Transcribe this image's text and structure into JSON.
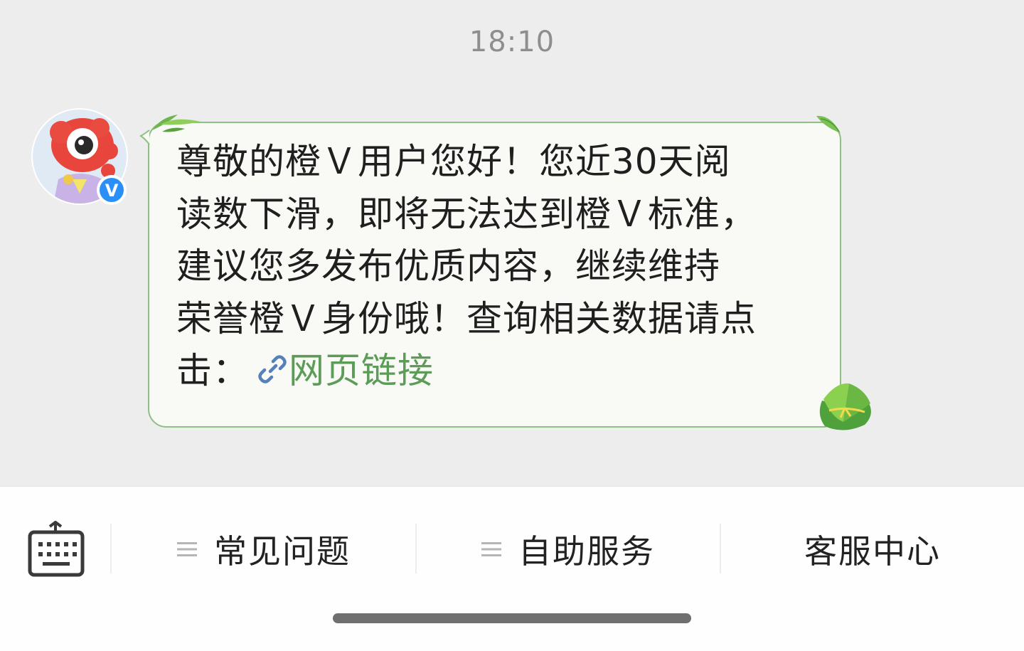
{
  "chat": {
    "timestamp": "18:10",
    "message": {
      "lines": [
        "尊敬的橙Ｖ用户您好！您近30天阅",
        "读数下滑，即将无法达到橙Ｖ标准，",
        "建议您多发布优质内容，继续维持",
        "荣誉橙Ｖ身份哦！查询相关数据请点",
        "击："
      ],
      "link_text": "网页链接",
      "link_icon": "link-icon"
    },
    "avatar": {
      "badge": "V",
      "icon": "weibo-mascot-avatar"
    }
  },
  "bottom_bar": {
    "keyboard_icon": "keyboard-icon",
    "menus": [
      {
        "label": "常见问题",
        "icon": "menu-lines-icon"
      },
      {
        "label": "自助服务",
        "icon": "menu-lines-icon"
      },
      {
        "label": "客服中心"
      }
    ]
  },
  "colors": {
    "background": "#ededed",
    "bubble_fill": "#f9faf5",
    "bubble_border": "#8ebf84",
    "link": "#5c9b58",
    "verified_badge": "#2a8ff7"
  }
}
